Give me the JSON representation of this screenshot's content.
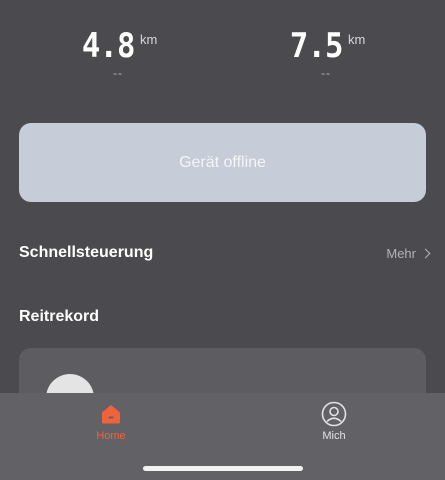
{
  "stats": [
    {
      "value": "4.8",
      "unit": "km",
      "sub": "--"
    },
    {
      "value": "7.5",
      "unit": "km",
      "sub": "--"
    }
  ],
  "device_status": {
    "label": "Gerät offline"
  },
  "quick_control": {
    "title": "Schnellsteuerung",
    "more_label": "Mehr"
  },
  "ride_record": {
    "title": "Reitrekord"
  },
  "tab_bar": {
    "tabs": [
      {
        "label": "Home",
        "icon": "home-icon",
        "active": true
      },
      {
        "label": "Mich",
        "icon": "profile-icon",
        "active": false
      }
    ]
  },
  "colors": {
    "accent": "#f0623a",
    "background": "#4a4a4f",
    "status_card": "#c7ccd9"
  }
}
